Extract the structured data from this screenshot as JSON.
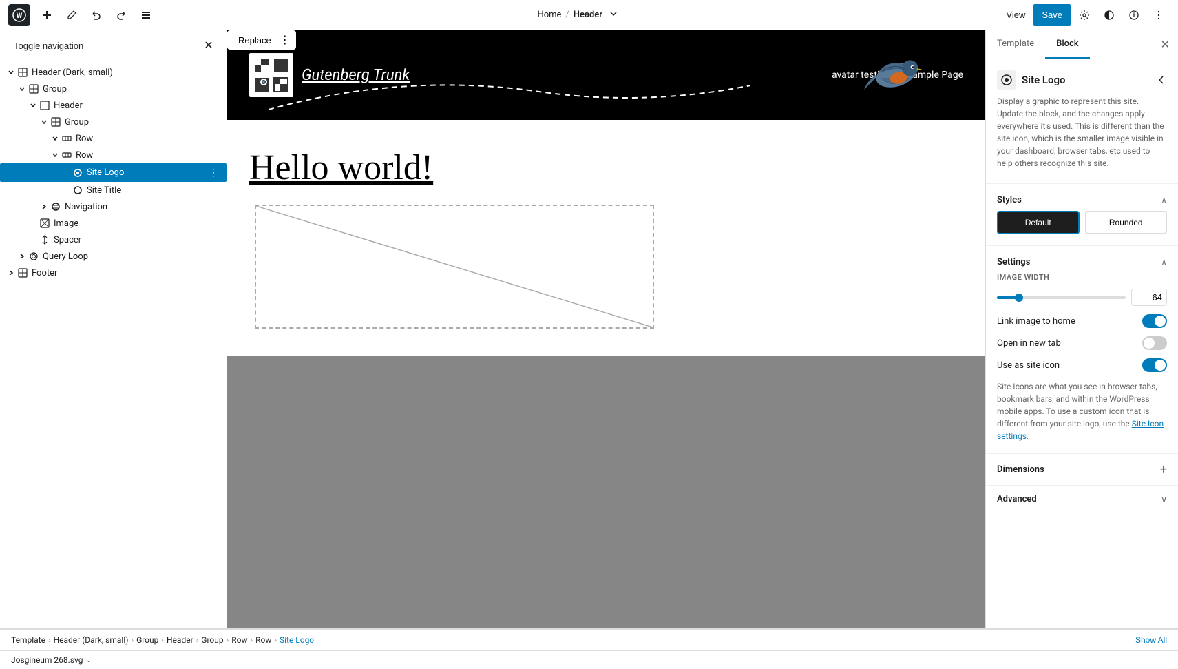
{
  "topbar": {
    "wp_logo": "W",
    "add_btn": "+",
    "edit_btn": "✏",
    "undo_btn": "↩",
    "redo_btn": "↪",
    "list_view_btn": "☰",
    "breadcrumb": {
      "home": "Home",
      "active": "Header",
      "chevron": "⌄"
    },
    "view_btn": "View",
    "save_btn": "Save",
    "gear_icon": "⚙",
    "theme_icon": "◑",
    "info_icon": "ℹ",
    "more_icon": "⋮"
  },
  "sidebar": {
    "toggle_nav": "Toggle navigation",
    "close_btn": "✕",
    "tree": [
      {
        "id": "header-dark-small",
        "label": "Header (Dark, small)",
        "indent": 0,
        "icon": "⊞",
        "expanded": true,
        "expandable": true
      },
      {
        "id": "group-1",
        "label": "Group",
        "indent": 1,
        "icon": "⊞",
        "expanded": true,
        "expandable": true
      },
      {
        "id": "header-1",
        "label": "Header",
        "indent": 2,
        "icon": "⊡",
        "expanded": true,
        "expandable": true
      },
      {
        "id": "group-2",
        "label": "Group",
        "indent": 3,
        "icon": "⊞",
        "expanded": true,
        "expandable": true
      },
      {
        "id": "row-1",
        "label": "Row",
        "indent": 4,
        "icon": "⊟",
        "expanded": true,
        "expandable": true
      },
      {
        "id": "row-2",
        "label": "Row",
        "indent": 4,
        "icon": "⊟",
        "expanded": true,
        "expandable": true
      },
      {
        "id": "site-logo",
        "label": "Site Logo",
        "indent": 5,
        "icon": "◎",
        "expanded": false,
        "expandable": false,
        "selected": true
      },
      {
        "id": "site-title",
        "label": "Site Title",
        "indent": 5,
        "icon": "○",
        "expanded": false,
        "expandable": false
      },
      {
        "id": "navigation",
        "label": "Navigation",
        "indent": 3,
        "icon": "◉",
        "expanded": false,
        "expandable": true
      },
      {
        "id": "image",
        "label": "Image",
        "indent": 2,
        "icon": "⊠",
        "expanded": false,
        "expandable": false
      },
      {
        "id": "spacer",
        "label": "Spacer",
        "indent": 2,
        "icon": "↕",
        "expanded": false,
        "expandable": false
      },
      {
        "id": "query-loop",
        "label": "Query Loop",
        "indent": 1,
        "icon": "⊚",
        "expanded": false,
        "expandable": true
      },
      {
        "id": "footer",
        "label": "Footer",
        "indent": 0,
        "icon": "⊞",
        "expanded": false,
        "expandable": true
      }
    ]
  },
  "canvas": {
    "header": {
      "site_name": "Gutenberg Trunk",
      "nav_links": [
        "avatar testing",
        "Sample Page"
      ],
      "replace_btn": "Replace",
      "more_btn": "⋮"
    },
    "content": {
      "hello_world": "Hello world!"
    }
  },
  "right_panel": {
    "tabs": [
      {
        "id": "template",
        "label": "Template"
      },
      {
        "id": "block",
        "label": "Block",
        "active": true
      }
    ],
    "close_btn": "✕",
    "block": {
      "icon": "◎",
      "name": "Site Logo",
      "description": "Display a graphic to represent this site. Update the block, and the changes apply everywhere it's used. This is different than the site icon, which is the smaller image visible in your dashboard, browser tabs, etc used to help others recognize this site."
    },
    "styles": {
      "label": "Styles",
      "options": [
        {
          "id": "default",
          "label": "Default",
          "active": true
        },
        {
          "id": "rounded",
          "label": "Rounded",
          "active": false
        }
      ]
    },
    "settings": {
      "label": "Settings",
      "image_width_label": "IMAGE WIDTH",
      "image_width_value": "64",
      "image_width_percent": 15,
      "link_image_label": "Link image to home",
      "link_image_on": true,
      "open_new_tab_label": "Open in new tab",
      "open_new_tab_on": false,
      "use_site_icon_label": "Use as site icon",
      "use_site_icon_on": true,
      "site_icon_desc": "Site Icons are what you see in browser tabs, bookmark bars, and within the WordPress mobile apps. To use a custom icon that is different from your site logo, use the",
      "site_icon_link_text": "Site Icon settings",
      "site_icon_suffix": "."
    },
    "dimensions": {
      "label": "Dimensions",
      "add_icon": "+"
    },
    "advanced": {
      "label": "Advanced",
      "chevron": "⌃"
    }
  },
  "bottom_breadcrumb": {
    "items": [
      "Template",
      "Header (Dark, small)",
      "Group",
      "Header",
      "Group",
      "Row",
      "Row",
      "Site Logo"
    ],
    "show_all": "Show All"
  },
  "bottom_bar": {
    "font_label": "Josgineum 268.svg",
    "chevron": "⌄"
  }
}
